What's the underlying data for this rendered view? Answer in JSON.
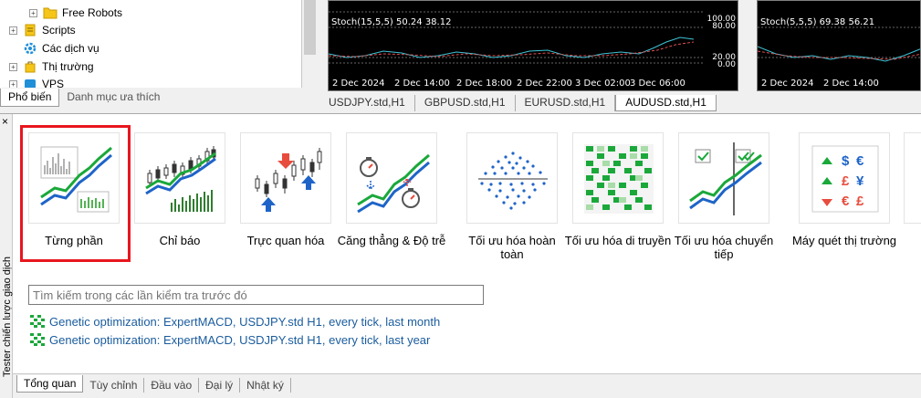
{
  "navigator": {
    "tree": [
      {
        "label": "Free Robots",
        "icon": "folder-icon"
      },
      {
        "label": "Scripts",
        "icon": "scripts-icon"
      },
      {
        "label": "Các dịch vụ",
        "icon": "services-gear-icon"
      },
      {
        "label": "Thị trường",
        "icon": "market-bag-icon"
      },
      {
        "label": "VPS",
        "icon": "vps-icon"
      }
    ],
    "tabs": [
      "Phổ biến",
      "Danh mục ưa thích"
    ]
  },
  "charts": [
    {
      "indicator": "Stoch(15,5,5) 50.24 38.12",
      "levels": [
        "100.00",
        "80.00",
        "20.00",
        "0.00"
      ],
      "dates": [
        "2 Dec 2024",
        "2 Dec 14:00",
        "2 Dec 18:00",
        "2 Dec 22:00",
        "3 Dec 02:00",
        "3 Dec 06:00"
      ]
    },
    {
      "indicator": "Stoch(5,5,5) 69.38 56.21",
      "dates": [
        "2 Dec 2024",
        "2 Dec 14:00"
      ]
    }
  ],
  "chart_tabs": [
    "USDJPY.std,H1",
    "GBPUSD.std,H1",
    "EURUSD.std,H1",
    "AUDUSD.std,H1"
  ],
  "tester": {
    "panel_label": "Tester chiến lược giao dịch",
    "close_glyph": "×",
    "modes": [
      {
        "label": "Từng phần",
        "icon": "single-test-icon",
        "selected": true
      },
      {
        "label": "Chỉ báo",
        "icon": "indicator-icon"
      },
      {
        "label": "Trực quan hóa",
        "icon": "visualization-icon"
      },
      {
        "label": "Căng thẳng & Độ trễ",
        "icon": "stress-delay-icon"
      },
      {
        "label": "Tối ưu hóa hoàn toàn",
        "icon": "full-optimization-icon"
      },
      {
        "label": "Tối ưu hóa di truyền",
        "icon": "genetic-optimization-icon"
      },
      {
        "label": "Tối ưu hóa chuyển tiếp",
        "icon": "forward-optimization-icon"
      },
      {
        "label": "Máy quét thị trường",
        "icon": "market-scanner-icon"
      }
    ],
    "search_placeholder": "Tìm kiếm trong các lần kiểm tra trước đó",
    "recent": [
      "Genetic optimization: ExpertMACD, USDJPY.std H1, every tick, last month",
      "Genetic optimization: ExpertMACD, USDJPY.std H1, every tick, last year"
    ],
    "bottom_tabs": [
      "Tổng quan",
      "Tùy chỉnh",
      "Đầu vào",
      "Đại lý",
      "Nhật ký"
    ]
  },
  "colors": {
    "selection": "#e8161e",
    "link": "#1a5c9e",
    "chart_bg": "#000000",
    "stoch_main": "#3ec3d6",
    "stoch_signal": "#e05050"
  }
}
